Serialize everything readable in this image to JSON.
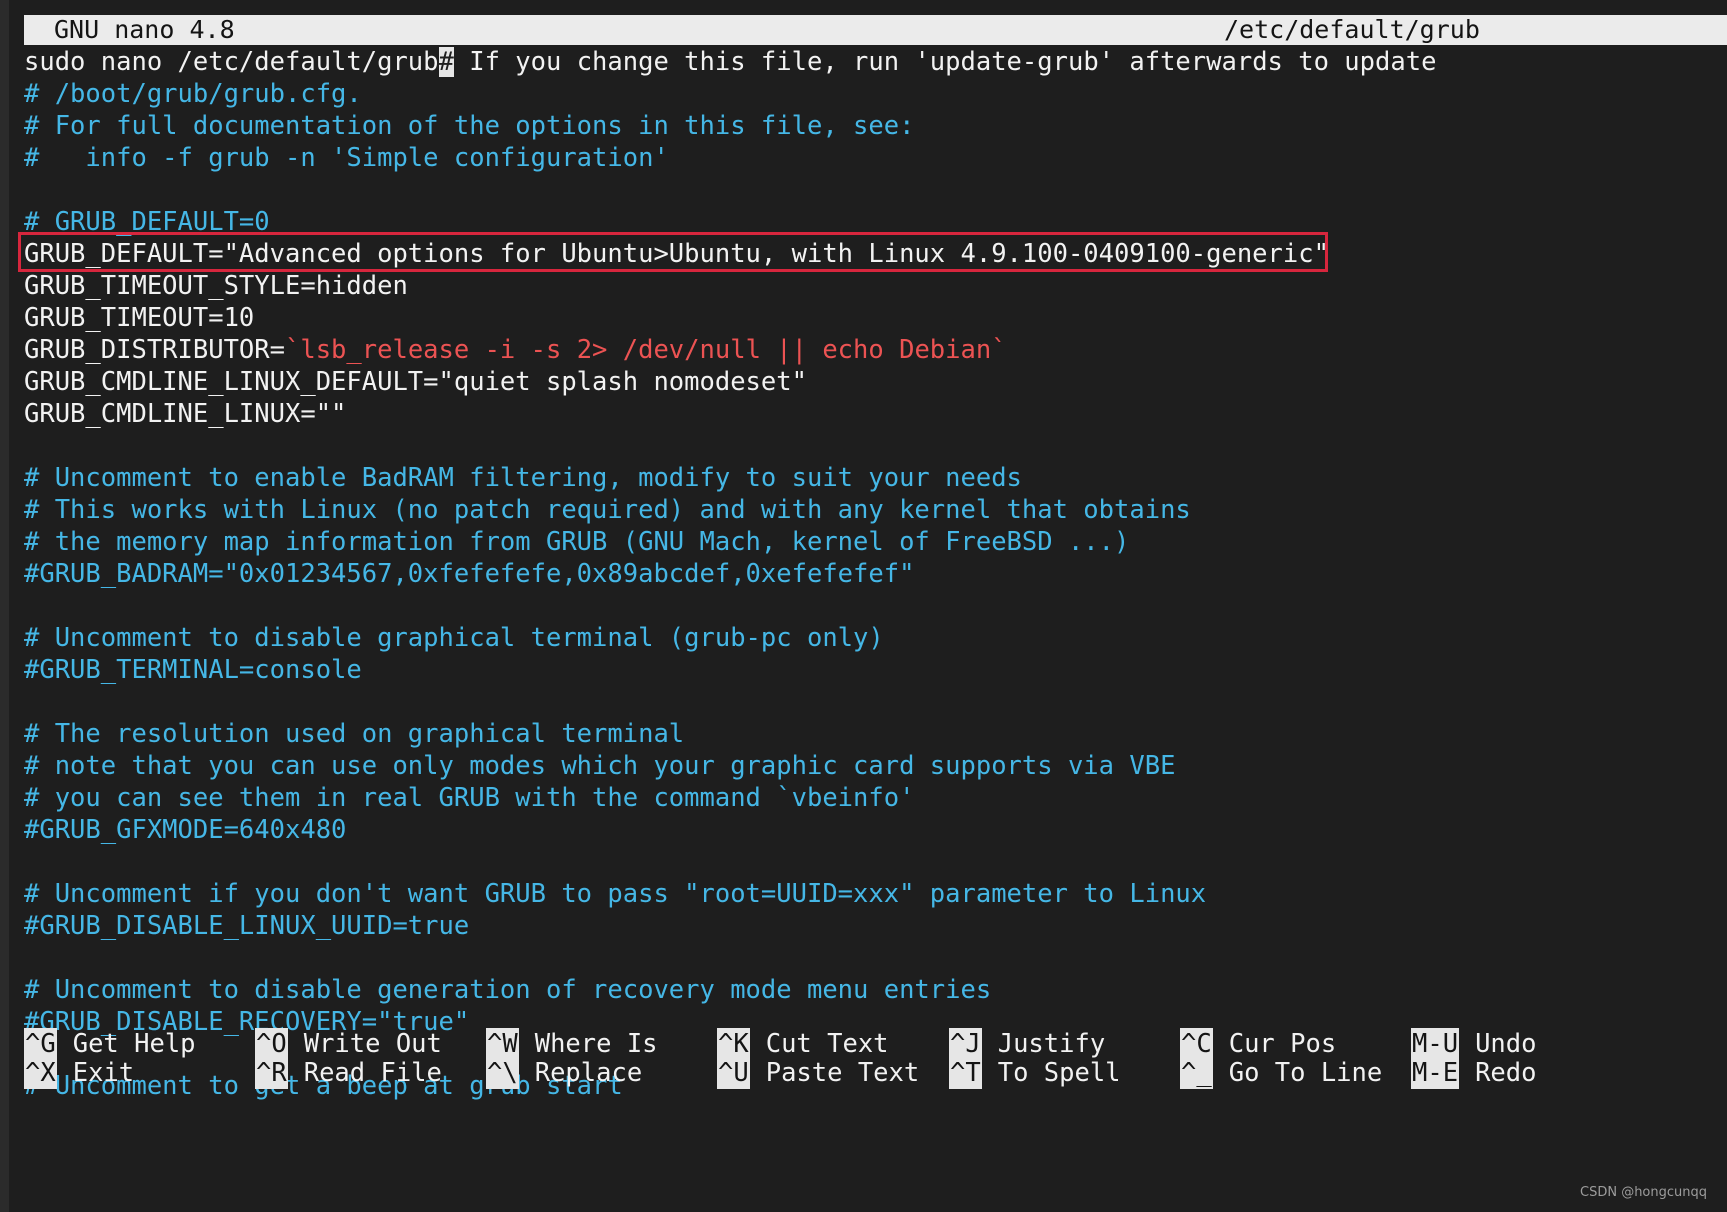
{
  "title_bar": {
    "app": "GNU nano 4.8",
    "file": "/etc/default/grub"
  },
  "lines": [
    {
      "segments": [
        {
          "text": "sudo nano /etc/default/grub",
          "style": "normal"
        },
        {
          "text": "#",
          "style": "cursor"
        },
        {
          "text": " If you change this file, run 'update-grub' afterwards to update",
          "style": "normal"
        }
      ]
    },
    {
      "segments": [
        {
          "text": "# /boot/grub/grub.cfg.",
          "style": "comment"
        }
      ]
    },
    {
      "segments": [
        {
          "text": "# For full documentation of the options in this file, see:",
          "style": "comment"
        }
      ]
    },
    {
      "segments": [
        {
          "text": "#   info -f grub -n 'Simple configuration'",
          "style": "comment"
        }
      ]
    },
    {
      "segments": []
    },
    {
      "segments": [
        {
          "text": "# GRUB_DEFAULT=0",
          "style": "comment"
        }
      ]
    },
    {
      "segments": [
        {
          "text": "GRUB_DEFAULT=\"Advanced options for Ubuntu>Ubuntu, with Linux 4.9.100-0409100-generic\"",
          "style": "normal"
        }
      ]
    },
    {
      "segments": [
        {
          "text": "GRUB_TIMEOUT_STYLE=hidden",
          "style": "normal"
        }
      ]
    },
    {
      "segments": [
        {
          "text": "GRUB_TIMEOUT=10",
          "style": "normal"
        }
      ]
    },
    {
      "segments": [
        {
          "text": "GRUB_DISTRIBUTOR=",
          "style": "normal"
        },
        {
          "text": "`lsb_release -i -s 2> /dev/null || echo Debian`",
          "style": "string"
        }
      ]
    },
    {
      "segments": [
        {
          "text": "GRUB_CMDLINE_LINUX_DEFAULT=\"quiet splash nomodeset\"",
          "style": "normal"
        }
      ]
    },
    {
      "segments": [
        {
          "text": "GRUB_CMDLINE_LINUX=\"\"",
          "style": "normal"
        }
      ]
    },
    {
      "segments": []
    },
    {
      "segments": [
        {
          "text": "# Uncomment to enable BadRAM filtering, modify to suit your needs",
          "style": "comment"
        }
      ]
    },
    {
      "segments": [
        {
          "text": "# This works with Linux (no patch required) and with any kernel that obtains",
          "style": "comment"
        }
      ]
    },
    {
      "segments": [
        {
          "text": "# the memory map information from GRUB (GNU Mach, kernel of FreeBSD ...)",
          "style": "comment"
        }
      ]
    },
    {
      "segments": [
        {
          "text": "#GRUB_BADRAM=\"0x01234567,0xfefefefe,0x89abcdef,0xefefefef\"",
          "style": "comment"
        }
      ]
    },
    {
      "segments": []
    },
    {
      "segments": [
        {
          "text": "# Uncomment to disable graphical terminal (grub-pc only)",
          "style": "comment"
        }
      ]
    },
    {
      "segments": [
        {
          "text": "#GRUB_TERMINAL=console",
          "style": "comment"
        }
      ]
    },
    {
      "segments": []
    },
    {
      "segments": [
        {
          "text": "# The resolution used on graphical terminal",
          "style": "comment"
        }
      ]
    },
    {
      "segments": [
        {
          "text": "# note that you can use only modes which your graphic card supports via VBE",
          "style": "comment"
        }
      ]
    },
    {
      "segments": [
        {
          "text": "# you can see them in real GRUB with the command `vbeinfo'",
          "style": "comment"
        }
      ]
    },
    {
      "segments": [
        {
          "text": "#GRUB_GFXMODE=640x480",
          "style": "comment"
        }
      ]
    },
    {
      "segments": []
    },
    {
      "segments": [
        {
          "text": "# Uncomment if you don't want GRUB to pass \"root=UUID=xxx\" parameter to Linux",
          "style": "comment"
        }
      ]
    },
    {
      "segments": [
        {
          "text": "#GRUB_DISABLE_LINUX_UUID=true",
          "style": "comment"
        }
      ]
    },
    {
      "segments": []
    },
    {
      "segments": [
        {
          "text": "# Uncomment to disable generation of recovery mode menu entries",
          "style": "comment"
        }
      ]
    },
    {
      "segments": [
        {
          "text": "#GRUB_DISABLE_RECOVERY=\"true\"",
          "style": "comment"
        }
      ]
    },
    {
      "segments": []
    },
    {
      "segments": [
        {
          "text": "# Uncomment to get a beep at grub start",
          "style": "comment"
        }
      ]
    }
  ],
  "shortcuts": [
    [
      {
        "key": "^G",
        "label": "Get Help"
      },
      {
        "key": "^X",
        "label": "Exit"
      }
    ],
    [
      {
        "key": "^O",
        "label": "Write Out"
      },
      {
        "key": "^R",
        "label": "Read File"
      }
    ],
    [
      {
        "key": "^W",
        "label": "Where Is"
      },
      {
        "key": "^\\",
        "label": "Replace"
      }
    ],
    [
      {
        "key": "^K",
        "label": "Cut Text"
      },
      {
        "key": "^U",
        "label": "Paste Text"
      }
    ],
    [
      {
        "key": "^J",
        "label": "Justify"
      },
      {
        "key": "^T",
        "label": "To Spell"
      }
    ],
    [
      {
        "key": "^C",
        "label": "Cur Pos"
      },
      {
        "key": "^_",
        "label": "Go To Line"
      }
    ],
    [
      {
        "key": "M-U",
        "label": "Undo"
      },
      {
        "key": "M-E",
        "label": "Redo"
      }
    ]
  ],
  "watermark": "CSDN @hongcunqq",
  "colors": {
    "background": "#1e1e1e",
    "comment": "#45b7e6",
    "string": "#ec5353",
    "highlight_box": "#d7263d",
    "title_bar": "#ebebeb"
  }
}
